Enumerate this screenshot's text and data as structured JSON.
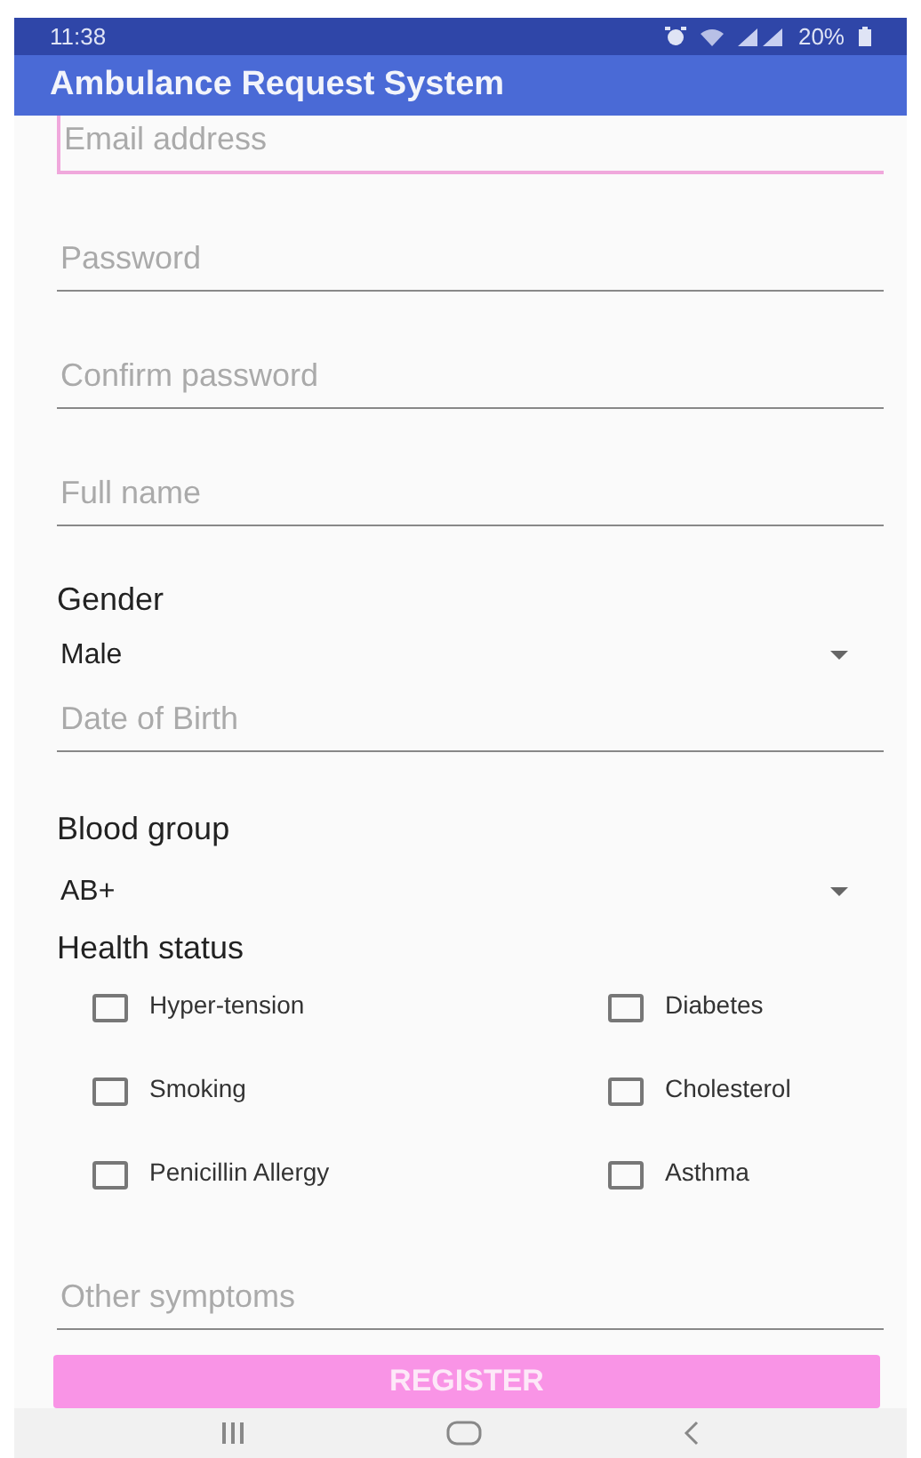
{
  "status_bar": {
    "time": "11:38",
    "battery": "20%"
  },
  "app_bar": {
    "title": "Ambulance Request System"
  },
  "fields_top": [
    {
      "placeholder": "Email address",
      "focused": true
    },
    {
      "placeholder": "Password",
      "focused": false
    },
    {
      "placeholder": "Confirm password",
      "focused": false
    },
    {
      "placeholder": "Full name",
      "focused": false
    }
  ],
  "gender": {
    "label": "Gender",
    "value": "Male"
  },
  "date_of_birth": {
    "placeholder": "Date of Birth",
    "focused": false
  },
  "blood_group": {
    "label": "Blood group",
    "value": "AB+"
  },
  "health_status": {
    "label": "Health status",
    "options": [
      {
        "label": "Hyper-tension",
        "checked": false
      },
      {
        "label": "Diabetes",
        "checked": false
      },
      {
        "label": "Smoking",
        "checked": false
      },
      {
        "label": "Cholesterol",
        "checked": false
      },
      {
        "label": "Penicillin Allergy",
        "checked": false
      },
      {
        "label": "Asthma",
        "checked": false
      }
    ]
  },
  "other_symptoms": {
    "placeholder": "Other symptoms",
    "focused": false
  },
  "register_button": {
    "label": "REGISTER"
  }
}
